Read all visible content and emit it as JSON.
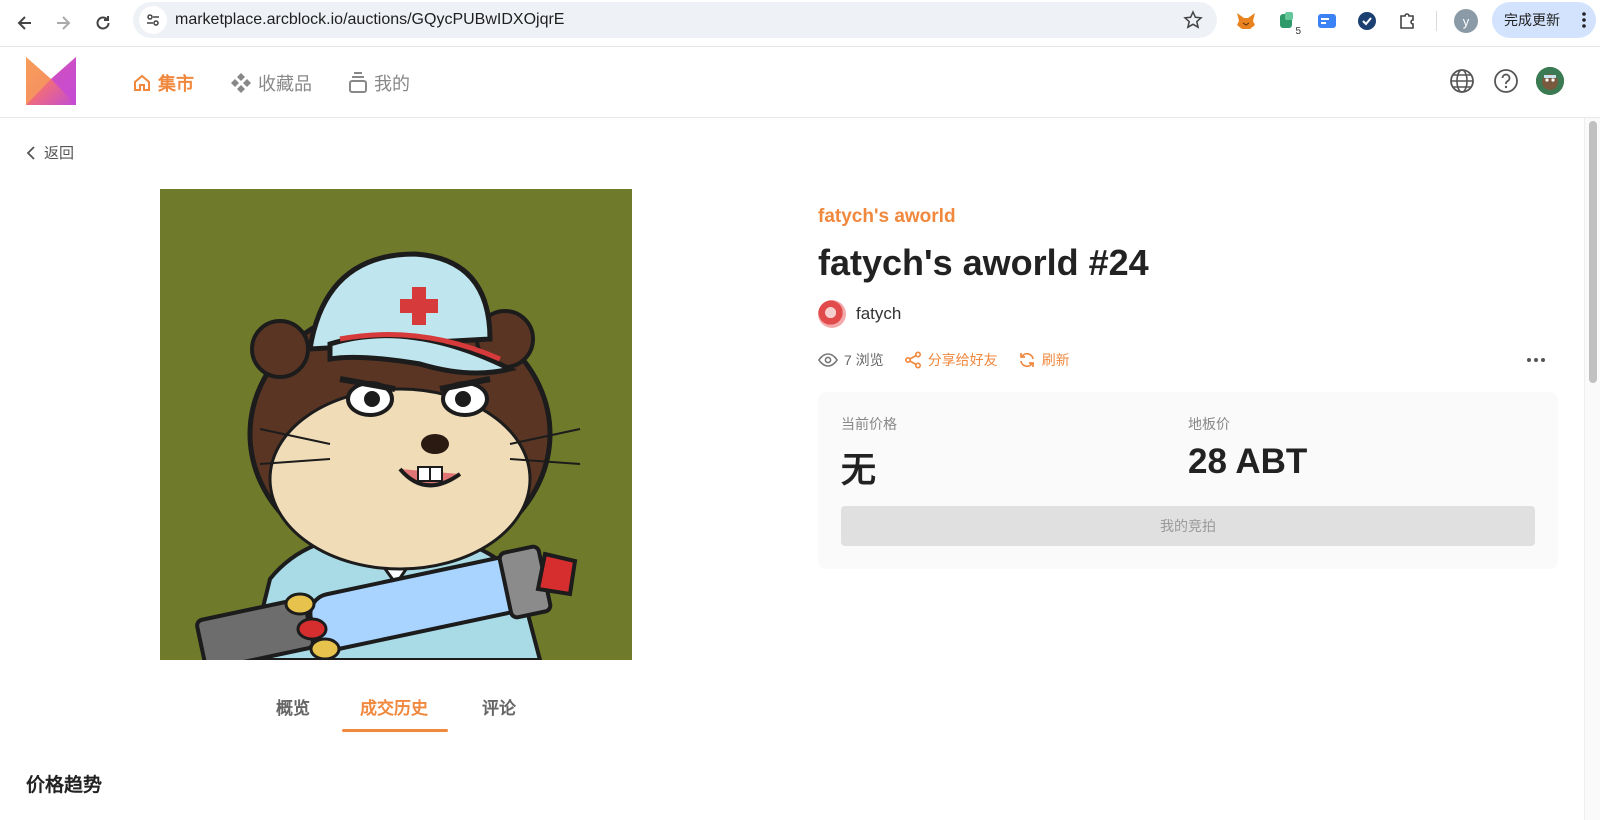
{
  "browser": {
    "url": "marketplace.arcblock.io/auctions/GQycPUBwIDXOjqrE",
    "extension_badge": "5",
    "profile_initial": "y",
    "update_label": "完成更新"
  },
  "site": {
    "nav": {
      "market": "集市",
      "collections": "收藏品",
      "mine": "我的"
    },
    "accent_color": "#f0883e"
  },
  "page": {
    "back_label": "返回",
    "collection_name": "fatych's aworld",
    "nft_title": "fatych's aworld #24",
    "owner_name": "fatych",
    "views_label": "7 浏览",
    "share_label": "分享给好友",
    "refresh_label": "刷新",
    "price": {
      "current_label": "当前价格",
      "current_value": "无",
      "floor_label": "地板价",
      "floor_value": "28 ABT",
      "bid_button": "我的竞拍"
    },
    "tabs": [
      {
        "label": "概览"
      },
      {
        "label": "成交历史"
      },
      {
        "label": "评论"
      }
    ],
    "active_tab": "成交历史",
    "section_title": "价格趋势"
  }
}
